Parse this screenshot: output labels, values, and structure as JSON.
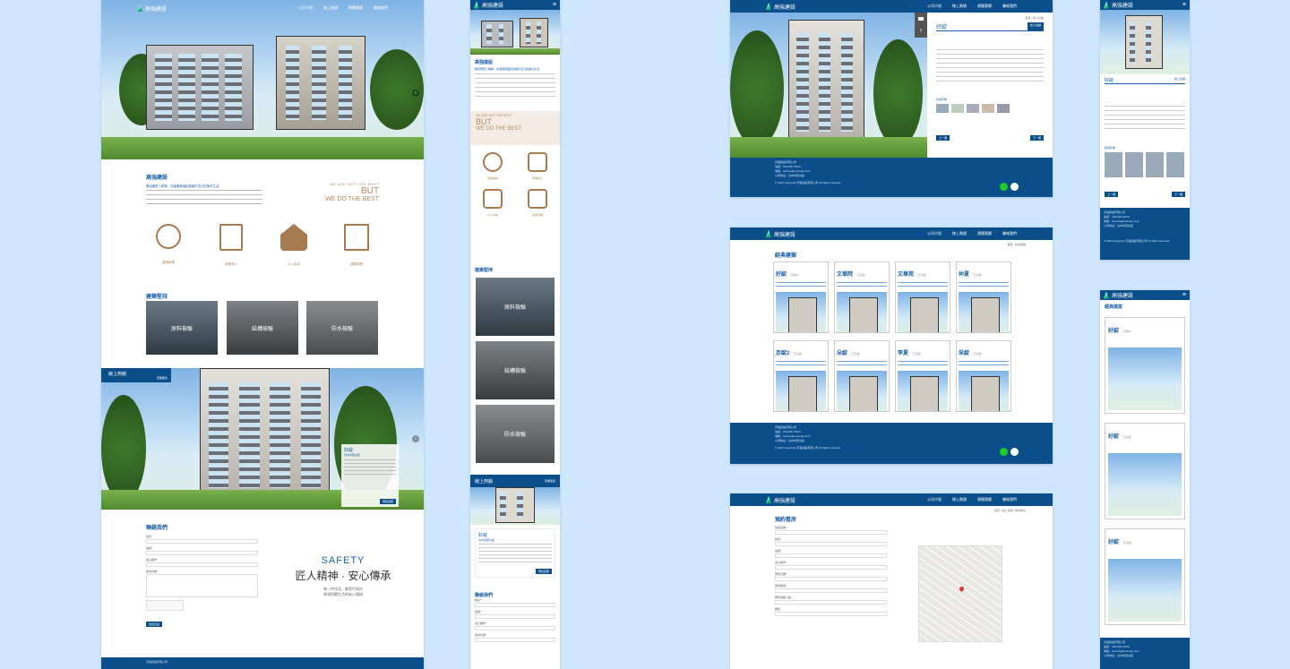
{
  "brand": {
    "name": "高強建設",
    "company": "高強建設有限公司"
  },
  "nav": [
    "公司介紹",
    "線上熱銷",
    "建築實績",
    "聯絡我們"
  ],
  "intro": {
    "title": "高強建設",
    "subtitle": "秉持著匠人精神，在每個家園創造屬於自己的美好生活",
    "slogan_top": "WE ARE NOT THE BEST",
    "slogan_mid": "BUT",
    "slogan_bot": "WE DO THE BEST"
  },
  "features": [
    {
      "label": "建築精神"
    },
    {
      "label": "專業用心"
    },
    {
      "label": "以人為本"
    },
    {
      "label": "建築專業"
    }
  ],
  "quality": {
    "title": "建築堅持",
    "items": [
      "原料檢驗",
      "結構檢驗",
      "防水檢驗"
    ]
  },
  "hot": {
    "title": "線上熱銷",
    "more": "查看更多",
    "name": "好綻",
    "sub": "台中市西屯區",
    "button": "預約賞屋"
  },
  "contact": {
    "title": "聯絡我們",
    "fields": [
      "姓名*",
      "電話*",
      "電子郵件*",
      "留言內容*"
    ],
    "placeholder": "請輸入",
    "submit": "送出表單",
    "tagline_top": "SAFETY",
    "tagline_main": "匠人精神 · 安心傳承",
    "tagline_sub1": "每一件作品，都是代表作",
    "tagline_sub2": "實現所屬生活的安心場域"
  },
  "detail": {
    "name": "好綻",
    "tag": "線上熱銷",
    "breadcrumb": "首頁 / 線上熱銷",
    "prev": "上一個",
    "next": "下一個",
    "gallery_title": "建案影像"
  },
  "portfolio": {
    "title": "經典建案",
    "breadcrumb": "首頁 / 建築實績",
    "items": [
      {
        "name": "好綻",
        "tag": "熱銷中"
      },
      {
        "name": "文華院",
        "tag": "已完銷"
      },
      {
        "name": "文華苑",
        "tag": "已完銷"
      },
      {
        "name": "仲夏",
        "tag": "已完銷"
      },
      {
        "name": "京綻2",
        "tag": "已完銷"
      },
      {
        "name": "朵綻",
        "tag": "已完銷"
      },
      {
        "name": "李夏",
        "tag": "已完銷"
      },
      {
        "name": "采綻",
        "tag": "已完銷"
      }
    ]
  },
  "booking": {
    "title": "預約看房",
    "breadcrumb": "首頁 / 線上熱銷 / 預約看房",
    "fields": [
      "建案名稱*",
      "姓名*",
      "電話*",
      "電子郵件*",
      "預約日期*",
      "預約時段*",
      "預約參觀人數",
      "備註"
    ]
  },
  "footer": {
    "phone": "電話：(04)2451-5420",
    "email": "信箱：service@example.com",
    "address": "公司地址：台中市西屯區",
    "copyright": "© 2024 Copyright 高強建設有限公司 All rights reserved."
  }
}
